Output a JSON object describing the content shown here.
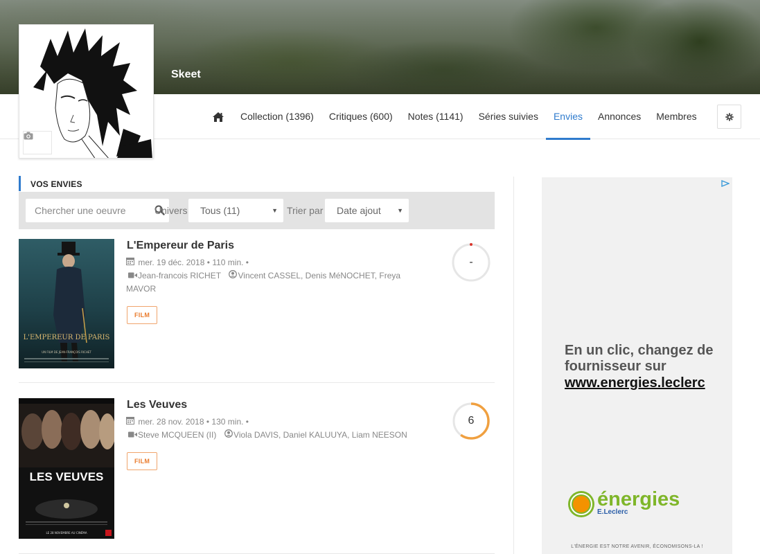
{
  "profile": {
    "username": "Skeet"
  },
  "nav": {
    "items": [
      {
        "label": "Collection (1396)",
        "active": false
      },
      {
        "label": "Critiques (600)",
        "active": false
      },
      {
        "label": "Notes (1141)",
        "active": false
      },
      {
        "label": "Séries suivies",
        "active": false
      },
      {
        "label": "Envies",
        "active": true
      },
      {
        "label": "Annonces",
        "active": false
      },
      {
        "label": "Membres",
        "active": false
      }
    ]
  },
  "section": {
    "title": "VOS ENVIES"
  },
  "filters": {
    "search_placeholder": "Chercher une oeuvre",
    "univers_label": "Univers",
    "univers_value": "Tous (11)",
    "sort_label": "Trier par",
    "sort_value": "Date ajout"
  },
  "items": [
    {
      "title": "L'Empereur de Paris",
      "date": "mer. 19 déc. 2018",
      "duration": "110 min.",
      "director": "Jean-francois RICHET",
      "actors": "Vincent CASSEL, Denis MéNOCHET, Freya MAVOR",
      "type": "FILM",
      "rating": "-",
      "poster_title": "L'EMPEREUR DE PARIS",
      "poster_subtitle": "UN FILM DE JEAN-FRANÇOIS RICHET"
    },
    {
      "title": "Les Veuves",
      "date": "mer. 28 nov. 2018",
      "duration": "130 min.",
      "director": "Steve MCQUEEN (II)",
      "actors": "Viola DAVIS, Daniel KALUUYA, Liam NEESON",
      "type": "FILM",
      "rating": "6",
      "poster_title": "LES VEUVES",
      "poster_subtitle": "LE 28 NOVEMBRE AU CINÉMA"
    }
  ],
  "ad": {
    "headline": "En un clic, changez de fournisseur sur",
    "link": "www.energies.leclerc",
    "brand": "énergies",
    "brand_sub": "E.Leclerc",
    "footer": "L'ÉNERGIE EST NOTRE AVENIR, ÉCONOMISONS-LA !"
  },
  "colors": {
    "accent": "#2f7bcd",
    "badge": "#ea7c2e",
    "rating_ring": "#f0a040"
  },
  "icons": {
    "home": "home-icon",
    "settings": "gear-icon",
    "search": "search-icon",
    "camera": "camera-icon",
    "calendar": "calendar-icon",
    "director": "video-camera-icon",
    "actors": "user-circle-icon"
  }
}
